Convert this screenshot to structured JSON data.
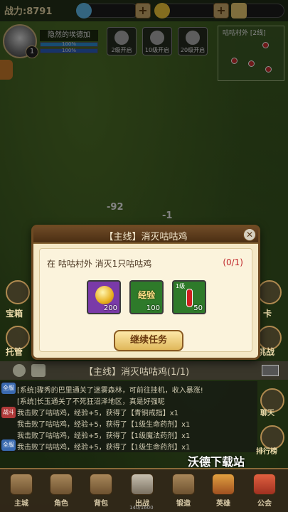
{
  "top_bar": {
    "power_label": "战力:",
    "power_value": "8791",
    "add_label": "+",
    "colors": {
      "gem": "#5fb8e8",
      "gold": "#f1c73a"
    }
  },
  "player": {
    "name": "隐然的埃德加",
    "level": "1",
    "hp_text": "100%",
    "mp_text": "100%"
  },
  "unlock_slots": [
    {
      "label": "2级开启"
    },
    {
      "label": "10级开启"
    },
    {
      "label": "20级开启"
    }
  ],
  "minimap": {
    "title": "咕咕村外 [2线]"
  },
  "battle_numbers": [
    "-92",
    "-1"
  ],
  "side_buttons": {
    "left_top": "宝箱",
    "left_bottom": "托管",
    "right_top": "卡",
    "right_bottom": "挑战",
    "right_chat": "聊天",
    "right_rank": "排行榜"
  },
  "quest_strip": {
    "text": "【主线】消灭咕咕鸡(1/1)"
  },
  "chat": {
    "lines": [
      {
        "tag": "全服",
        "tag_color": "#3a6ab0",
        "text": "[系统]骤秀的巴里通关了迷雾森林，可前往挂机，收入暴涨!"
      },
      {
        "tag": "",
        "tag_color": "#3a6ab0",
        "text": "[系统]长玉通关了不死狂沼泽地区，真是好强呢"
      },
      {
        "tag": "战斗",
        "tag_color": "#b03a3a",
        "text": "我击败了咕咕鸡，经验+5，获得了【青铜戒指】x1"
      },
      {
        "tag": "",
        "tag_color": "#b03a3a",
        "text": "我击败了咕咕鸡，经验+5，获得了【1级生命药剂】x1"
      },
      {
        "tag": "",
        "tag_color": "#b03a3a",
        "text": "我击败了咕咕鸡，经验+5，获得了【1级魔法药剂】x1"
      },
      {
        "tag": "全服",
        "tag_color": "#3a6ab0",
        "text": "我击败了咕咕鸡，经验+5，获得了【1级生命药剂】x1"
      }
    ]
  },
  "nav": {
    "items": [
      {
        "label": "主城"
      },
      {
        "label": "角色"
      },
      {
        "label": "背包"
      },
      {
        "label": "出战"
      },
      {
        "label": "锻造"
      },
      {
        "label": "英雄"
      },
      {
        "label": "公会"
      }
    ],
    "xp_text": "140/1600"
  },
  "watermark": "沃德下载站",
  "dialog": {
    "title": "【主线】消灭咕咕鸡",
    "description": "在 咕咕村外 消灭1只咕咕鸡",
    "progress": "(0/1)",
    "rewards": [
      {
        "icon": "gold-coin-icon",
        "amount": "200",
        "bg": "#7a3aa8"
      },
      {
        "icon": "exp-icon",
        "word": "经验",
        "amount": "100",
        "bg": "#2e7a2a"
      },
      {
        "icon": "potion-icon",
        "level": "1级",
        "amount": "50",
        "bg": "#2e7a2a"
      }
    ],
    "continue_label": "继续任务",
    "close_glyph": "✕"
  }
}
